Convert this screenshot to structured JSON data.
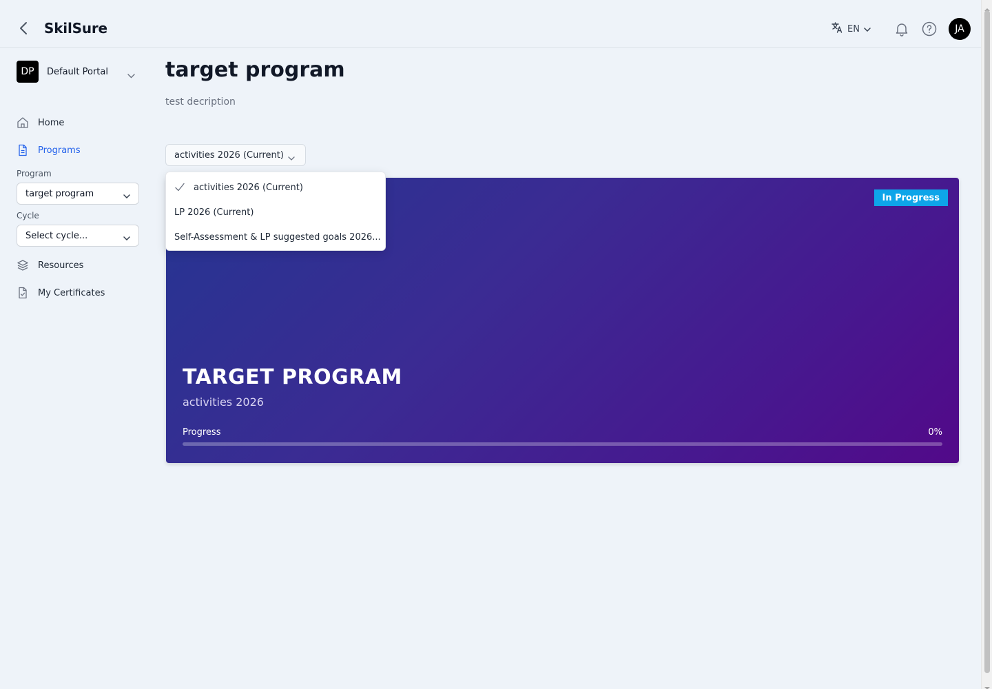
{
  "header": {
    "brand": "SkilSure",
    "language": "EN",
    "user_initials": "JA"
  },
  "sidebar": {
    "portal": {
      "initials": "DP",
      "name": "Default Portal"
    },
    "items": [
      {
        "label": "Home",
        "icon": "home-icon"
      },
      {
        "label": "Programs",
        "icon": "document-icon",
        "active": true
      },
      {
        "label": "Resources",
        "icon": "layers-icon"
      },
      {
        "label": "My Certificates",
        "icon": "certificate-icon"
      }
    ],
    "program_label": "Program",
    "program_value": "target program",
    "cycle_label": "Cycle",
    "cycle_value": "Select cycle..."
  },
  "main": {
    "title": "target program",
    "description": "test decription",
    "cycle_selector": "activities 2026 (Current)",
    "dropdown_options": [
      {
        "label": "activities 2026 (Current)",
        "selected": true
      },
      {
        "label": "LP 2026 (Current)",
        "selected": false
      },
      {
        "label": "Self-Assessment & LP suggested goals 2026...",
        "selected": false
      }
    ],
    "hero": {
      "status": "In Progress",
      "title": "TARGET PROGRAM",
      "subtitle": "activities 2026",
      "progress_label": "Progress",
      "progress_text": "0%",
      "progress_fraction": 0
    }
  },
  "colors": {
    "accent": "#2563eb",
    "badge": "#0ea5e9",
    "hero_start": "#253591",
    "hero_end": "#520989"
  }
}
